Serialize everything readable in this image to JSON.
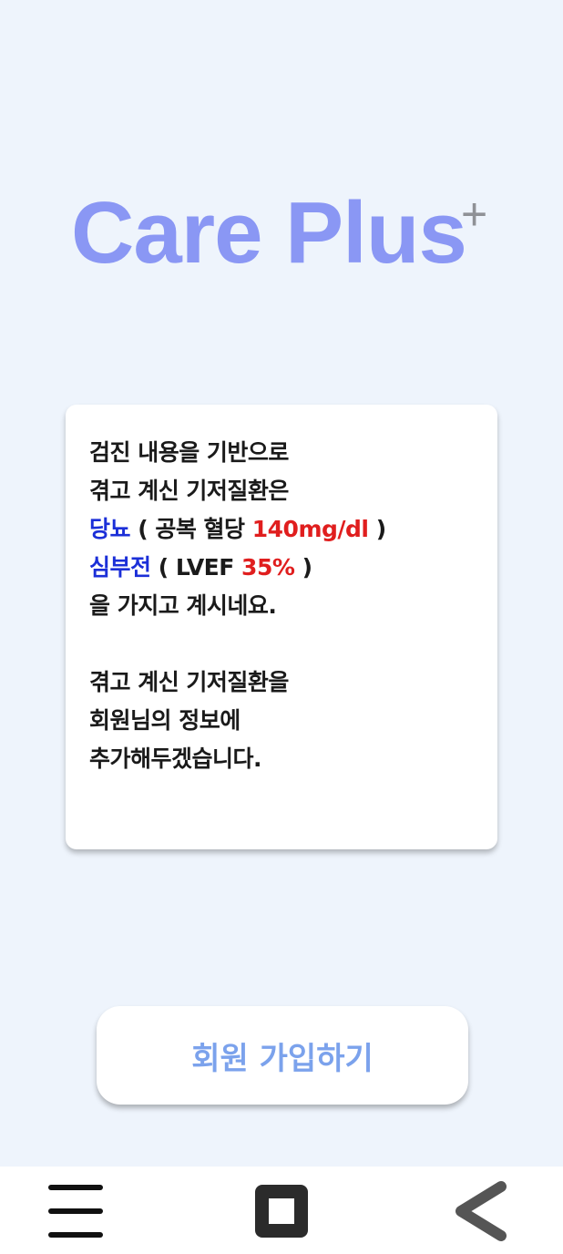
{
  "logo": {
    "text": "Care Plus",
    "superscript": "+",
    "color": "#8a97f4",
    "plus_color": "#8f9196"
  },
  "card": {
    "line1": "검진 내용을 기반으로",
    "line2": "겪고 계신 기저질환은",
    "line3": {
      "condition": "당뇨",
      "open": " ( 공복 혈당 ",
      "value": "140mg/dl",
      "close": " )"
    },
    "line4": {
      "condition": "심부전",
      "open": " ( LVEF ",
      "value": "35%",
      "close": " )"
    },
    "line5": "을 가지고 계시네요.",
    "line6": "겪고 계신 기저질환을",
    "line7": "회원님의 정보에",
    "line8": "추가해두겠습니다."
  },
  "signup_button": {
    "label": "회원 가입하기",
    "color": "#7ba2ec"
  },
  "navbar": {
    "menu_icon": "menu-icon",
    "home_icon": "home-square-icon",
    "back_icon": "back-chevron-icon"
  },
  "colors": {
    "background": "#eef4fc",
    "highlight_condition": "#1b2fd8",
    "highlight_value": "#e01e1e"
  }
}
